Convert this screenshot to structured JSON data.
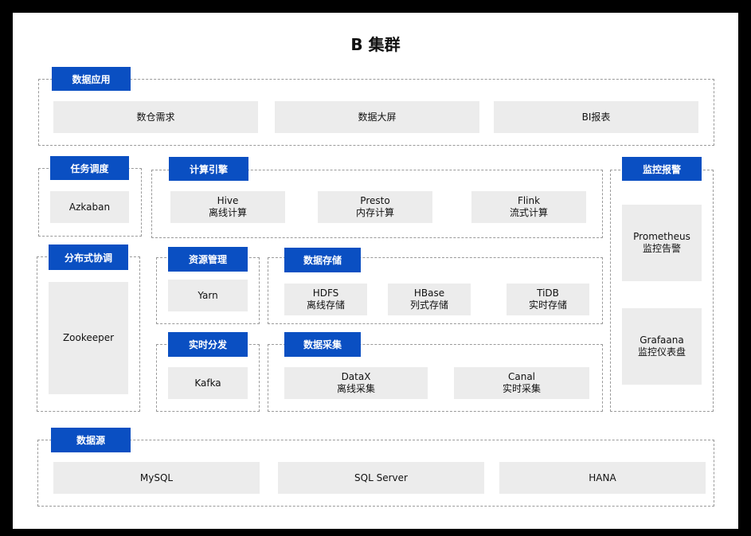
{
  "title": "B 集群",
  "sections": {
    "data_app": {
      "label": "数据应用",
      "items": [
        {
          "name": "数仓需求"
        },
        {
          "name": "数据大屏"
        },
        {
          "name": "BI报表"
        }
      ]
    },
    "scheduling": {
      "label": "任务调度",
      "items": [
        {
          "name": "Azkaban"
        }
      ]
    },
    "compute": {
      "label": "计算引擎",
      "items": [
        {
          "name": "Hive",
          "desc": "离线计算"
        },
        {
          "name": "Presto",
          "desc": "内存计算"
        },
        {
          "name": "Flink",
          "desc": "流式计算"
        }
      ]
    },
    "monitoring": {
      "label": "监控报警",
      "items": [
        {
          "name": "Prometheus",
          "desc": "监控告警"
        },
        {
          "name": "Grafaana",
          "desc": "监控仪表盘"
        }
      ]
    },
    "coordination": {
      "label": "分布式协调",
      "items": [
        {
          "name": "Zookeeper"
        }
      ]
    },
    "resource": {
      "label": "资源管理",
      "items": [
        {
          "name": "Yarn"
        }
      ]
    },
    "storage": {
      "label": "数据存储",
      "items": [
        {
          "name": "HDFS",
          "desc": "离线存储"
        },
        {
          "name": "HBase",
          "desc": "列式存储"
        },
        {
          "name": "TiDB",
          "desc": "实时存储"
        }
      ]
    },
    "realtime": {
      "label": "实时分发",
      "items": [
        {
          "name": "Kafka"
        }
      ]
    },
    "collection": {
      "label": "数据采集",
      "items": [
        {
          "name": "DataX",
          "desc": "离线采集"
        },
        {
          "name": "Canal",
          "desc": "实时采集"
        }
      ]
    },
    "sources": {
      "label": "数据源",
      "items": [
        {
          "name": "MySQL"
        },
        {
          "name": "SQL Server"
        },
        {
          "name": "HANA"
        }
      ]
    }
  },
  "colors": {
    "tag_bg": "#0a4fc2",
    "box_bg": "#ececec",
    "border": "#9a9a9a"
  }
}
